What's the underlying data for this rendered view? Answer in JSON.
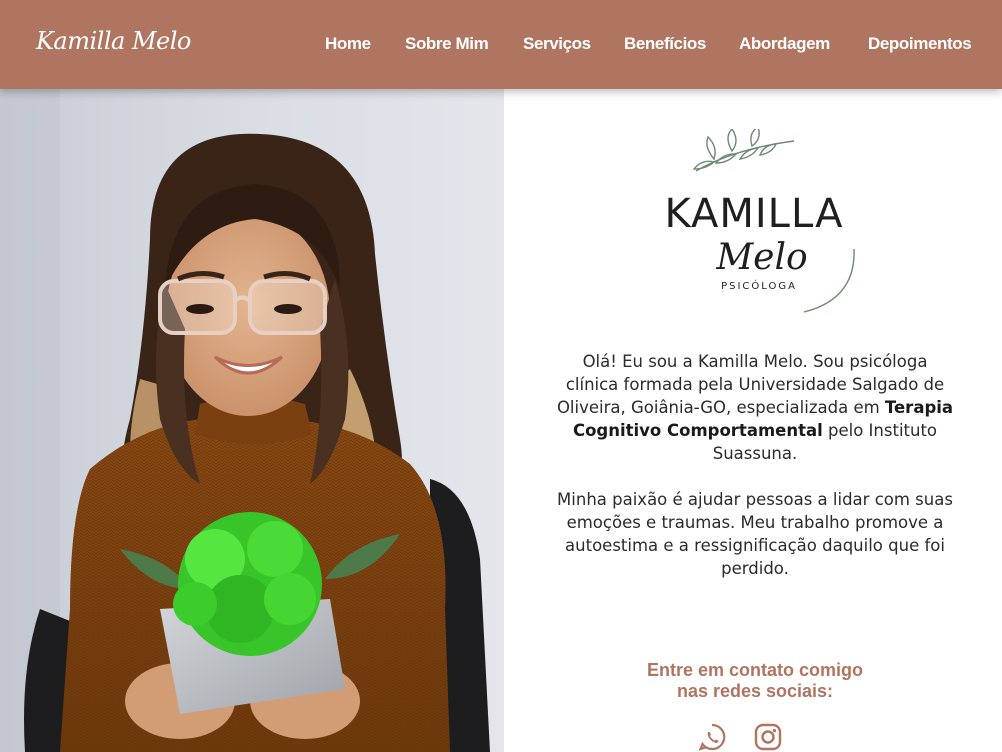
{
  "header": {
    "brand": "Kamilla Melo",
    "nav": [
      {
        "id": "home",
        "label": "Home"
      },
      {
        "id": "sobre-mim",
        "label": "Sobre Mim"
      },
      {
        "id": "servicos",
        "label": "Serviços"
      },
      {
        "id": "beneficios",
        "label": "Benefícios"
      },
      {
        "id": "abordagem",
        "label": "Abordagem"
      },
      {
        "id": "depoimentos",
        "label": "Depoimentos"
      }
    ]
  },
  "logo": {
    "name": "KAMILLA",
    "script": "Melo",
    "role": "PSICÓLOGA",
    "icon": "leaf-branch-icon"
  },
  "intro": {
    "p1_before": "Olá! Eu sou a Kamilla Melo. Sou psicóloga clínica formada pela Universidade Salgado de Oliveira, Goiânia-GO, especializada em ",
    "p1_bold": "Terapia Cognitivo Comportamental",
    "p1_after": " pelo Instituto Suassuna.",
    "p2": "Minha paixão é ajudar pessoas a lidar com suas emoções e traumas. Meu trabalho promove a autoestima e a ressignificação daquilo que foi perdido."
  },
  "contact": {
    "line1": "Entre em contato comigo",
    "line2": "nas redes sociais:",
    "icons": [
      "whatsapp-icon",
      "instagram-icon"
    ]
  },
  "colors": {
    "accent": "#b07560",
    "text": "#2b2b2b",
    "logo_green": "#6f8a74"
  }
}
